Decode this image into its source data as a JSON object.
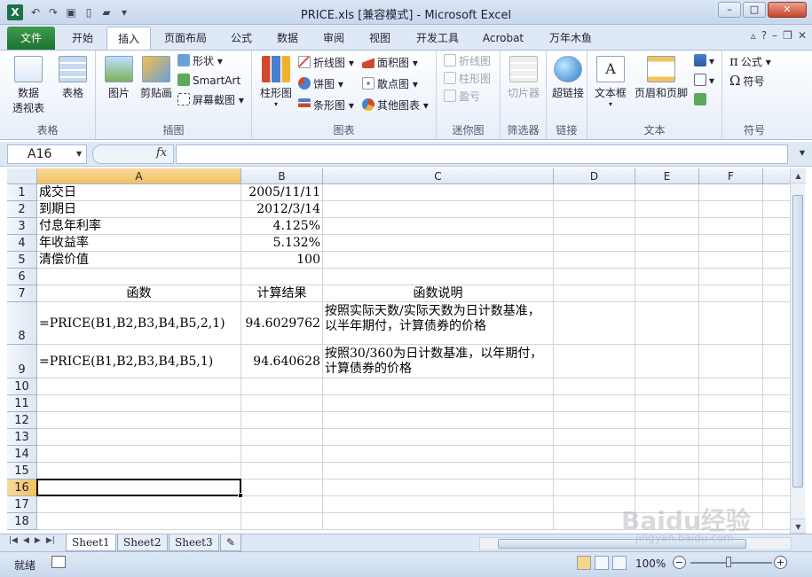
{
  "window": {
    "title": "PRICE.xls  [兼容模式]  -  Microsoft Excel",
    "app_icon": "X",
    "min": "–",
    "max": "□",
    "close": "✕"
  },
  "ribbon_tabs": [
    "文件",
    "开始",
    "插入",
    "页面布局",
    "公式",
    "数据",
    "审阅",
    "视图",
    "开发工具",
    "Acrobat",
    "万年木鱼"
  ],
  "active_tab": "插入",
  "ribbon": {
    "groups": {
      "tables": {
        "label": "表格",
        "pivot": "数据\n透视表",
        "table": "表格"
      },
      "illustrations": {
        "label": "插图",
        "picture": "图片",
        "clipart": "剪贴画",
        "shapes": "形状",
        "smartart": "SmartArt",
        "screenshot": "屏幕截图"
      },
      "charts": {
        "label": "图表",
        "column": "柱形图",
        "line": "折线图",
        "pie": "饼图",
        "bar": "条形图",
        "area": "面积图",
        "scatter": "散点图",
        "other": "其他图表"
      },
      "sparklines": {
        "label": "迷你图",
        "line": "折线图",
        "column": "柱形图",
        "winloss": "盈亏"
      },
      "filter": {
        "label": "筛选器",
        "slicer": "切片器"
      },
      "links": {
        "label": "链接",
        "hyperlink": "超链接"
      },
      "text": {
        "label": "文本",
        "textbox": "文本框",
        "header_footer": "页眉和页脚"
      },
      "symbols": {
        "label": "符号",
        "equation": "公式",
        "symbol": "符号"
      }
    }
  },
  "formula_bar": {
    "name_box": "A16",
    "fx": "fx",
    "formula": ""
  },
  "columns": [
    "A",
    "B",
    "C",
    "D",
    "E",
    "F"
  ],
  "rows": [
    "1",
    "2",
    "3",
    "4",
    "5",
    "6",
    "7",
    "8",
    "9",
    "10",
    "11",
    "12",
    "13",
    "14",
    "15",
    "16",
    "17",
    "18"
  ],
  "cells": {
    "A1": "成交日",
    "B1": "2005/11/11",
    "A2": "到期日",
    "B2": "2012/3/14",
    "A3": "付息年利率",
    "B3": "4.125%",
    "A4": "年收益率",
    "B4": "5.132%",
    "A5": "清偿价值",
    "B5": "100",
    "A7": "函数",
    "B7": "计算结果",
    "C7": "函数说明",
    "A8": "=PRICE(B1,B2,B3,B4,B5,2,1)",
    "B8": "94.6029762",
    "C8": "按照实际天数/实际天数为日计数基准，以半年期付，计算债券的价格",
    "A9": "=PRICE(B1,B2,B3,B4,B5,1)",
    "B9": "94.640628",
    "C9": "按照30/360为日计数基准，以年期付，计算债券的价格"
  },
  "sheets": [
    "Sheet1",
    "Sheet2",
    "Sheet3"
  ],
  "active_sheet": "Sheet1",
  "status": {
    "ready": "就绪",
    "zoom": "100%",
    "minus": "−",
    "plus": "+"
  },
  "watermark": {
    "logo": "Baidu经验",
    "url": "jingyan.baidu.com"
  },
  "colors": {
    "file_tab": "#1d7233",
    "selected_header": "#f1c15f",
    "grid_line": "#d4d4d4"
  }
}
